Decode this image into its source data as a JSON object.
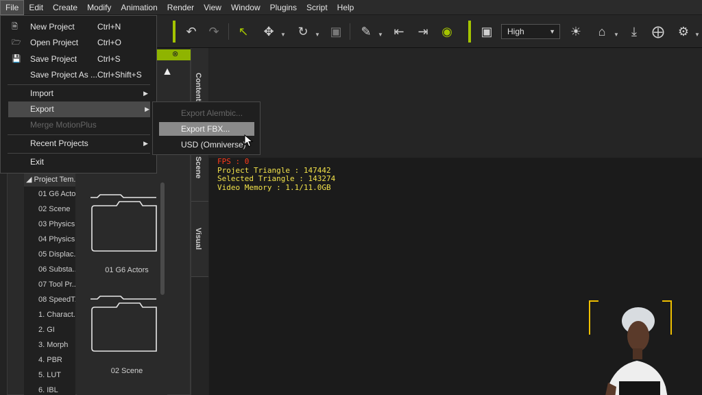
{
  "menubar": {
    "items": [
      "File",
      "Edit",
      "Create",
      "Modify",
      "Animation",
      "Render",
      "View",
      "Window",
      "Plugins",
      "Script",
      "Help"
    ]
  },
  "toolbar": {
    "quality_value": "High",
    "icons": [
      "undo-icon",
      "redo-icon",
      "select-arrow-icon",
      "move-icon",
      "rotate-icon",
      "scale-icon",
      "align-tool-icon",
      "align-left-icon",
      "align-right-icon",
      "eye-icon",
      "window-icon",
      "sun-icon",
      "home-icon",
      "download-icon",
      "expand-icon",
      "settings-icon"
    ]
  },
  "file_menu": {
    "items": [
      {
        "label": "New Project",
        "shortcut": "Ctrl+N",
        "icon": "new-file-icon"
      },
      {
        "label": "Open Project",
        "shortcut": "Ctrl+O",
        "icon": "open-folder-icon"
      },
      {
        "label": "Save Project",
        "shortcut": "Ctrl+S",
        "icon": "save-icon"
      },
      {
        "label": "Save Project As ...",
        "shortcut": "Ctrl+Shift+S"
      },
      {
        "label": "Import"
      },
      {
        "label": "Export"
      },
      {
        "label": "Merge MotionPlus"
      },
      {
        "label": "Recent Projects"
      },
      {
        "label": "Exit"
      }
    ]
  },
  "export_menu": {
    "items": [
      {
        "label": "Export Alembic..."
      },
      {
        "label": "Export FBX..."
      },
      {
        "label": "USD (Omniverse)"
      }
    ]
  },
  "side_tabs": [
    "Content",
    "Scene",
    "Visual"
  ],
  "tree": {
    "header": "Project Tem...",
    "items": [
      "01 G6 Acto...",
      "02 Scene",
      "03 Physics",
      "04 Physics",
      "05 Displac...",
      "06 Substa...",
      "07 Tool Pr...",
      "08 SpeedT...",
      "1. Charact...",
      "2. GI",
      "3. Morph",
      "4. PBR",
      "5. LUT",
      "6. IBL"
    ]
  },
  "thumbnails": [
    {
      "label": "01 G6 Actors"
    },
    {
      "label": "02 Scene"
    }
  ],
  "stats": {
    "fps": "FPS : 0",
    "project_triangle": "Project Triangle : 147442",
    "selected_triangle": "Selected Triangle : 143274",
    "video_memory": "Video Memory : 1.1/11.0GB"
  },
  "colors": {
    "accent": "#a4c400",
    "fps": "#ff3a1a",
    "stats": "#f2e24a",
    "bracket": "#f0c000"
  }
}
